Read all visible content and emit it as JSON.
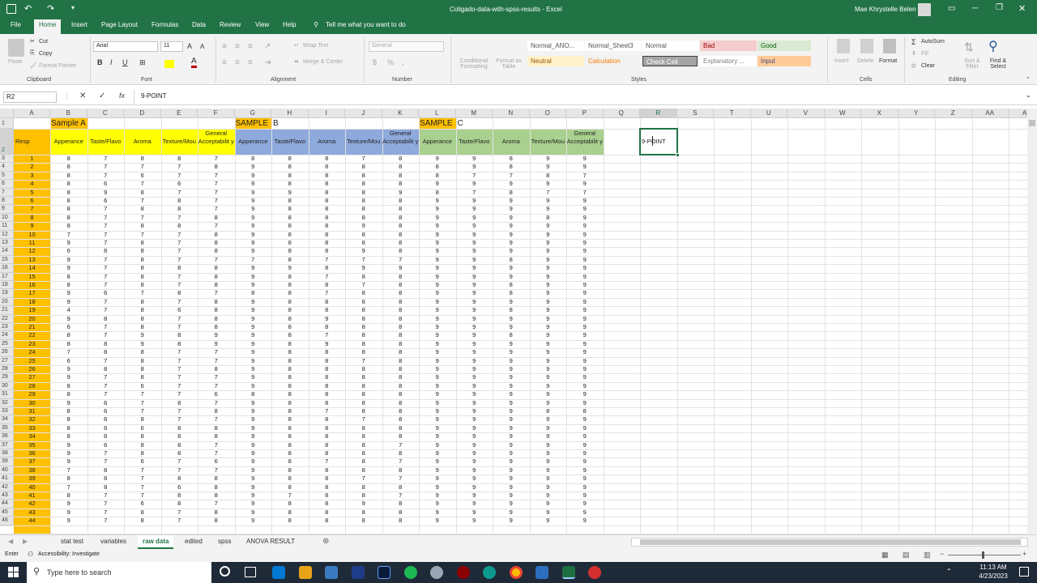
{
  "window": {
    "title": "Coligado-data-with-spss-results  -  Excel",
    "user": "Mae Khrystelle Belen"
  },
  "ribbon_tabs": [
    "File",
    "Home",
    "Insert",
    "Page Layout",
    "Formulas",
    "Data",
    "Review",
    "View",
    "Help"
  ],
  "tell_me": "Tell me what you want to do",
  "clipboard": {
    "paste": "Paste",
    "cut": "Cut",
    "copy": "Copy",
    "format_painter": "Format Painter",
    "label": "Clipboard"
  },
  "font": {
    "name": "Arial",
    "size": "11",
    "label": "Font"
  },
  "alignment": {
    "wrap": "Wrap Text",
    "merge": "Merge & Center",
    "label": "Alignment"
  },
  "number": {
    "format": "General",
    "label": "Number"
  },
  "styles": {
    "conditional": "Conditional Formatting",
    "format_table": "Format as Table",
    "cells": [
      {
        "name": "Normal_ANO...",
        "bg": "#ffffff",
        "fg": "#555555"
      },
      {
        "name": "Normal_Sheet3",
        "bg": "#ffffff",
        "fg": "#555555"
      },
      {
        "name": "Normal",
        "bg": "#ffffff",
        "fg": "#555555"
      },
      {
        "name": "Bad",
        "bg": "#f4cccc",
        "fg": "#9c0006"
      },
      {
        "name": "Good",
        "bg": "#d9ead3",
        "fg": "#006100"
      },
      {
        "name": "Neutral",
        "bg": "#fff2cc",
        "fg": "#9c5700"
      },
      {
        "name": "Calculation",
        "bg": "#f2f2f2",
        "fg": "#fa7d00"
      },
      {
        "name": "Check Cell",
        "bg": "#a5a5a5",
        "fg": "#ffffff"
      },
      {
        "name": "Explanatory ...",
        "bg": "#ffffff",
        "fg": "#7f7f7f"
      },
      {
        "name": "Input",
        "bg": "#ffcc99",
        "fg": "#3f3f76"
      }
    ],
    "label": "Styles"
  },
  "cells_group": {
    "insert": "Insert",
    "delete": "Delete",
    "format": "Format",
    "label": "Cells"
  },
  "editing": {
    "autosum": "AutoSum",
    "fill": "Fill",
    "clear": "Clear",
    "sort": "Sort & Filter",
    "find": "Find & Select",
    "label": "Editing"
  },
  "formula_bar": {
    "name_box": "R2",
    "content": "9-POINT"
  },
  "columns": [
    "A",
    "B",
    "C",
    "D",
    "E",
    "F",
    "G",
    "H",
    "I",
    "J",
    "K",
    "L",
    "M",
    "N",
    "O",
    "P",
    "Q",
    "R",
    "S",
    "T",
    "U",
    "V",
    "W",
    "X",
    "Y",
    "Z",
    "AA",
    "AB"
  ],
  "row_numbers": [
    "1",
    "2",
    "3",
    "4",
    "5",
    "6",
    "7",
    "8",
    "9",
    "10",
    "11",
    "12",
    "13",
    "14",
    "15",
    "16",
    "17",
    "18",
    "19",
    "20",
    "21",
    "22",
    "23",
    "24",
    "25",
    "26",
    "27",
    "28",
    "29",
    "30",
    "31",
    "32",
    "33",
    "34",
    "35",
    "36",
    "37",
    "38",
    "39",
    "40",
    "41",
    "42",
    "43",
    "44",
    "45",
    "46"
  ],
  "header1": {
    "sample_a": "Sample A",
    "sample_b": "SAMPLE",
    "sample_b2": "B",
    "sample_c": "SAMPLE",
    "sample_c2": "C"
  },
  "header2": {
    "resp": "Resp",
    "labels": [
      "Apperance",
      "Taste/Flavo",
      "Aroma",
      "Texture/Mou",
      "General Acceptabilit y"
    ],
    "active_cell": "9-POINT"
  },
  "colors": {
    "excel_green": "#217346",
    "resp_fill": "#ffc000",
    "sample_a_fill": "#ffff00",
    "sample_b_fill": "#8ea9db",
    "sample_c_fill": "#a9d08e"
  },
  "data_rows": [
    [
      "1",
      8,
      7,
      8,
      8,
      7,
      8,
      8,
      8,
      7,
      8,
      9,
      9,
      8,
      9,
      9
    ],
    [
      "2",
      8,
      7,
      7,
      7,
      8,
      9,
      8,
      8,
      8,
      8,
      8,
      9,
      8,
      9,
      9
    ],
    [
      "3",
      8,
      7,
      6,
      7,
      7,
      9,
      8,
      8,
      8,
      8,
      8,
      7,
      7,
      8,
      7
    ],
    [
      "4",
      8,
      6,
      7,
      6,
      7,
      9,
      8,
      8,
      8,
      8,
      9,
      9,
      9,
      9,
      9
    ],
    [
      "5",
      8,
      9,
      8,
      7,
      7,
      9,
      9,
      8,
      8,
      9,
      8,
      7,
      8,
      7,
      7
    ],
    [
      "6",
      8,
      6,
      7,
      8,
      7,
      9,
      8,
      8,
      8,
      8,
      9,
      9,
      9,
      9,
      9
    ],
    [
      "7",
      8,
      7,
      8,
      8,
      7,
      9,
      8,
      8,
      8,
      8,
      9,
      9,
      9,
      9,
      9
    ],
    [
      "8",
      8,
      7,
      7,
      7,
      8,
      9,
      8,
      8,
      8,
      8,
      9,
      9,
      9,
      8,
      9
    ],
    [
      "9",
      8,
      7,
      8,
      8,
      7,
      9,
      8,
      8,
      9,
      8,
      9,
      9,
      9,
      9,
      9
    ],
    [
      "10",
      7,
      7,
      7,
      7,
      8,
      9,
      8,
      8,
      8,
      8,
      9,
      9,
      9,
      9,
      9
    ],
    [
      "11",
      9,
      7,
      8,
      7,
      8,
      9,
      8,
      8,
      8,
      8,
      9,
      9,
      9,
      9,
      9
    ],
    [
      "12",
      6,
      8,
      8,
      7,
      8,
      9,
      8,
      8,
      9,
      8,
      9,
      9,
      9,
      9,
      9
    ],
    [
      "13",
      9,
      7,
      8,
      7,
      7,
      7,
      8,
      7,
      7,
      7,
      9,
      9,
      8,
      9,
      9
    ],
    [
      "14",
      9,
      7,
      8,
      8,
      8,
      9,
      9,
      8,
      9,
      9,
      9,
      9,
      9,
      9,
      9
    ],
    [
      "15",
      8,
      7,
      8,
      7,
      8,
      9,
      8,
      7,
      8,
      8,
      9,
      9,
      9,
      9,
      9
    ],
    [
      "16",
      8,
      7,
      8,
      7,
      8,
      9,
      8,
      8,
      7,
      8,
      9,
      9,
      8,
      9,
      9
    ],
    [
      "17",
      9,
      6,
      7,
      8,
      7,
      8,
      8,
      7,
      8,
      8,
      9,
      9,
      8,
      9,
      9
    ],
    [
      "18",
      9,
      7,
      8,
      7,
      8,
      9,
      8,
      8,
      8,
      8,
      9,
      9,
      9,
      9,
      9
    ],
    [
      "19",
      4,
      7,
      8,
      6,
      8,
      9,
      8,
      8,
      8,
      8,
      9,
      9,
      8,
      9,
      9
    ],
    [
      "20",
      9,
      8,
      8,
      7,
      8,
      9,
      8,
      9,
      8,
      8,
      9,
      9,
      9,
      9,
      9
    ],
    [
      "21",
      6,
      7,
      8,
      7,
      8,
      9,
      8,
      8,
      8,
      8,
      9,
      9,
      9,
      9,
      9
    ],
    [
      "22",
      8,
      7,
      9,
      8,
      9,
      9,
      8,
      7,
      8,
      8,
      9,
      9,
      8,
      9,
      9
    ],
    [
      "23",
      8,
      8,
      9,
      8,
      9,
      9,
      8,
      9,
      8,
      8,
      9,
      9,
      9,
      9,
      9
    ],
    [
      "24",
      7,
      8,
      8,
      7,
      7,
      9,
      8,
      8,
      8,
      8,
      9,
      9,
      9,
      9,
      9
    ],
    [
      "25",
      6,
      7,
      8,
      7,
      7,
      9,
      8,
      8,
      7,
      8,
      9,
      9,
      9,
      9,
      9
    ],
    [
      "26",
      9,
      8,
      8,
      7,
      8,
      9,
      8,
      8,
      8,
      8,
      9,
      9,
      9,
      9,
      9
    ],
    [
      "27",
      9,
      7,
      8,
      7,
      7,
      9,
      8,
      8,
      8,
      8,
      9,
      9,
      9,
      9,
      9
    ],
    [
      "28",
      8,
      7,
      6,
      7,
      7,
      9,
      8,
      8,
      8,
      8,
      9,
      9,
      9,
      9,
      9
    ],
    [
      "29",
      8,
      7,
      7,
      7,
      6,
      8,
      8,
      8,
      8,
      8,
      9,
      9,
      9,
      9,
      9
    ],
    [
      "30",
      9,
      6,
      7,
      8,
      7,
      9,
      8,
      8,
      8,
      8,
      9,
      9,
      9,
      9,
      9
    ],
    [
      "31",
      8,
      6,
      7,
      7,
      8,
      9,
      8,
      7,
      8,
      8,
      9,
      9,
      9,
      8,
      8
    ],
    [
      "32",
      8,
      6,
      8,
      7,
      7,
      9,
      8,
      8,
      7,
      8,
      9,
      9,
      9,
      9,
      9
    ],
    [
      "33",
      8,
      6,
      6,
      8,
      8,
      9,
      8,
      8,
      8,
      8,
      9,
      9,
      9,
      9,
      9
    ],
    [
      "34",
      8,
      6,
      8,
      8,
      8,
      9,
      8,
      8,
      8,
      8,
      9,
      9,
      9,
      9,
      9
    ],
    [
      "35",
      9,
      6,
      8,
      8,
      7,
      9,
      8,
      8,
      8,
      7,
      9,
      9,
      9,
      9,
      9
    ],
    [
      "36",
      9,
      7,
      8,
      8,
      7,
      9,
      8,
      8,
      8,
      8,
      9,
      9,
      9,
      9,
      9
    ],
    [
      "37",
      9,
      7,
      6,
      7,
      6,
      9,
      8,
      7,
      8,
      7,
      9,
      9,
      9,
      9,
      9
    ],
    [
      "38",
      7,
      8,
      7,
      7,
      7,
      9,
      8,
      8,
      8,
      8,
      9,
      9,
      9,
      9,
      9
    ],
    [
      "39",
      8,
      8,
      7,
      8,
      8,
      9,
      8,
      8,
      7,
      7,
      9,
      9,
      9,
      9,
      9
    ],
    [
      "40",
      7,
      8,
      7,
      6,
      8,
      9,
      8,
      8,
      8,
      8,
      9,
      9,
      9,
      9,
      9
    ],
    [
      "41",
      8,
      7,
      7,
      8,
      8,
      9,
      7,
      8,
      8,
      7,
      9,
      9,
      9,
      9,
      9
    ],
    [
      "42",
      9,
      7,
      6,
      8,
      7,
      9,
      8,
      8,
      9,
      8,
      9,
      9,
      9,
      9,
      9
    ],
    [
      "43",
      9,
      7,
      8,
      7,
      8,
      9,
      8,
      8,
      8,
      8,
      9,
      9,
      9,
      9,
      9
    ],
    [
      "44",
      9,
      7,
      8,
      7,
      8,
      9,
      8,
      8,
      8,
      8,
      9,
      9,
      9,
      9,
      9
    ]
  ],
  "sheet_tabs": [
    "stat test",
    "variables",
    "raw data",
    "edited",
    "spss",
    "ANOVA RESULT"
  ],
  "active_sheet": "raw data",
  "status": {
    "mode": "Enter",
    "accessibility": "Accessibility: Investigate"
  },
  "taskbar": {
    "search_placeholder": "Type here to search",
    "time": "11:13 AM",
    "date": "4/23/2023"
  }
}
